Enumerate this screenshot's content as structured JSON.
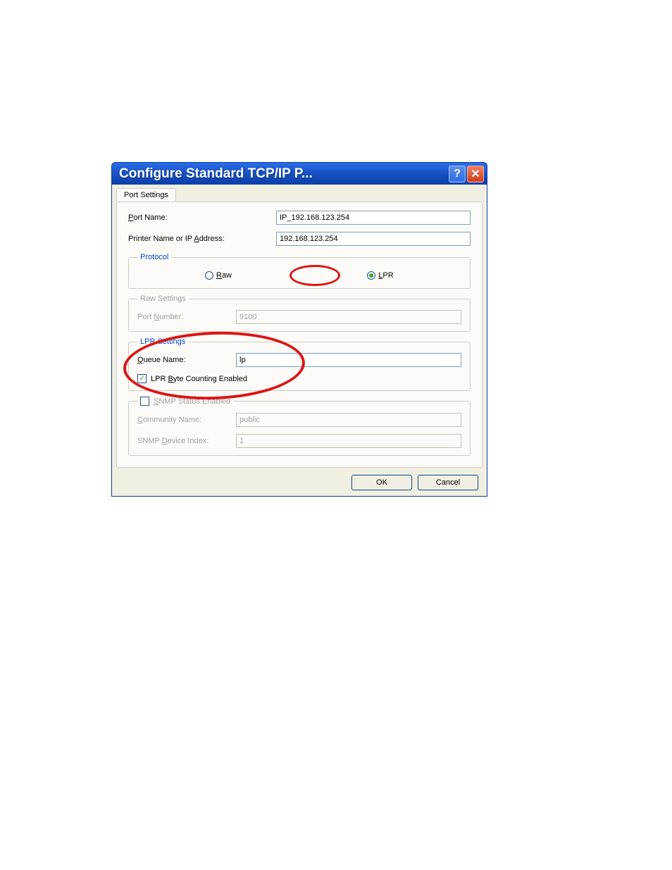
{
  "dialog": {
    "title": "Configure Standard TCP/IP P...",
    "tab_label": "Port Settings",
    "port_name_label": "Port Name:",
    "port_name_value": "IP_192.168.123.254",
    "ip_label": "Printer Name or IP Address:",
    "ip_value": "192.168.123.254",
    "protocol": {
      "legend": "Protocol",
      "raw_label": "Raw",
      "lpr_label": "LPR",
      "selected": "LPR"
    },
    "raw_settings": {
      "legend": "Raw Settings",
      "port_number_label": "Port Number:",
      "port_number_value": "9100"
    },
    "lpr_settings": {
      "legend": "LPR Settings",
      "queue_label": "Queue Name:",
      "queue_value": "lp",
      "byte_counting_label": "LPR Byte Counting Enabled",
      "byte_counting_checked": true
    },
    "snmp": {
      "legend": "SNMP Status Enabled",
      "checked": false,
      "community_label": "Community Name:",
      "community_value": "public",
      "device_index_label": "SNMP Device Index:",
      "device_index_value": "1"
    },
    "buttons": {
      "ok": "OK",
      "cancel": "Cancel"
    }
  }
}
